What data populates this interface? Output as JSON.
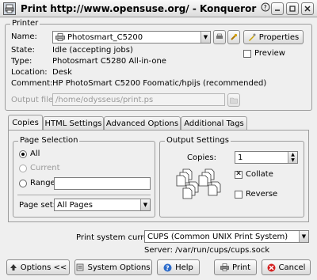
{
  "window": {
    "title": "Print http://www.opensuse.org/ - Konqueror",
    "help_glyph": "?⃝"
  },
  "printer": {
    "group_label": "Printer",
    "name_label": "Name:",
    "name_value": "Photosmart_C5200",
    "properties_label": "Properties",
    "preview_label": "Preview",
    "state_label": "State:",
    "state_value": "Idle (accepting jobs)",
    "type_label": "Type:",
    "type_value": "Photosmart C5280 All-in-one",
    "location_label": "Location:",
    "location_value": "Desk",
    "comment_label": "Comment:",
    "comment_value": "HP PhotoSmart C5200 Foomatic/hpijs (recommended)",
    "output_file_label": "Output file:",
    "output_file_value": "/home/odysseus/print.ps"
  },
  "tabs": [
    "Copies",
    "HTML Settings",
    "Advanced Options",
    "Additional Tags"
  ],
  "page_selection": {
    "group_label": "Page Selection",
    "all_label": "All",
    "current_label": "Current",
    "range_label": "Range",
    "range_value": "",
    "page_set_label": "Page set:",
    "page_set_value": "All Pages"
  },
  "output_settings": {
    "group_label": "Output Settings",
    "copies_label": "Copies:",
    "copies_value": "1",
    "collate_label": "Collate",
    "reverse_label": "Reverse",
    "collate_checked": true,
    "reverse_checked": false
  },
  "print_system": {
    "label": "Print system currently used:",
    "value": "CUPS (Common UNIX Print System)",
    "server_text": "Server: /var/run/cups/cups.sock"
  },
  "buttons": {
    "options": "Options <<",
    "system_options": "System Options",
    "help": "Help",
    "print": "Print",
    "cancel": "Cancel"
  }
}
